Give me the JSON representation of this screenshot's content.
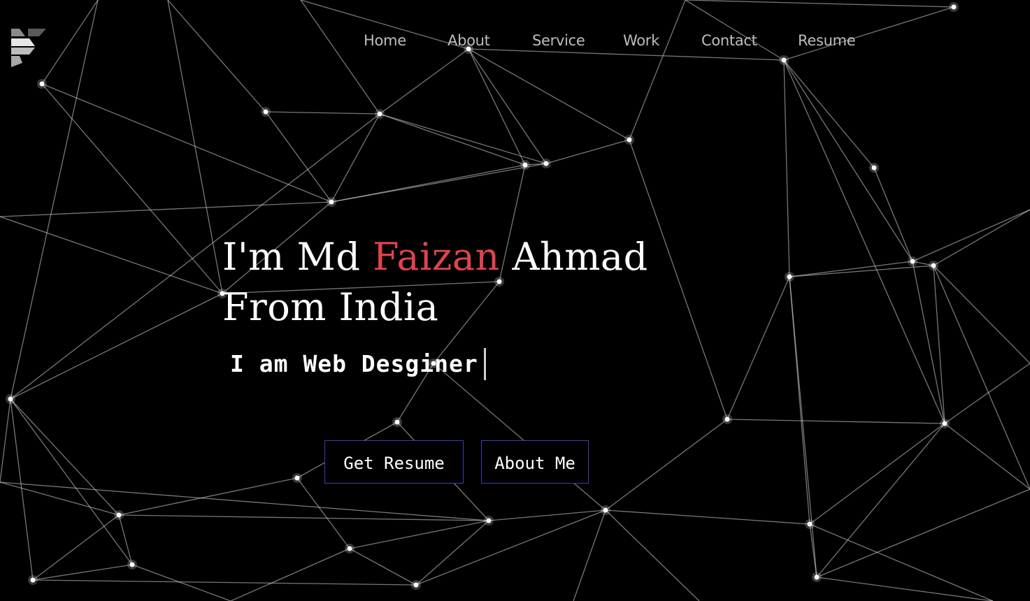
{
  "nav": {
    "items": [
      {
        "label": "Home"
      },
      {
        "label": "About"
      },
      {
        "label": "Service"
      },
      {
        "label": "Work"
      },
      {
        "label": "Contact"
      },
      {
        "label": "Resume"
      }
    ]
  },
  "hero": {
    "headline_prefix": "I'm Md ",
    "headline_highlight": "Faizan",
    "headline_suffix": " Ahmad",
    "headline_line2": "From India",
    "typed_text": "I am Web Desginer"
  },
  "buttons": {
    "resume_label": "Get Resume",
    "about_label": "About Me"
  },
  "colors": {
    "background": "#000000",
    "accent": "#e0434e",
    "nav_text": "#bdbdbd",
    "button_border": "#3a3fb0"
  },
  "icons": {
    "logo": "brand-logo-icon"
  }
}
